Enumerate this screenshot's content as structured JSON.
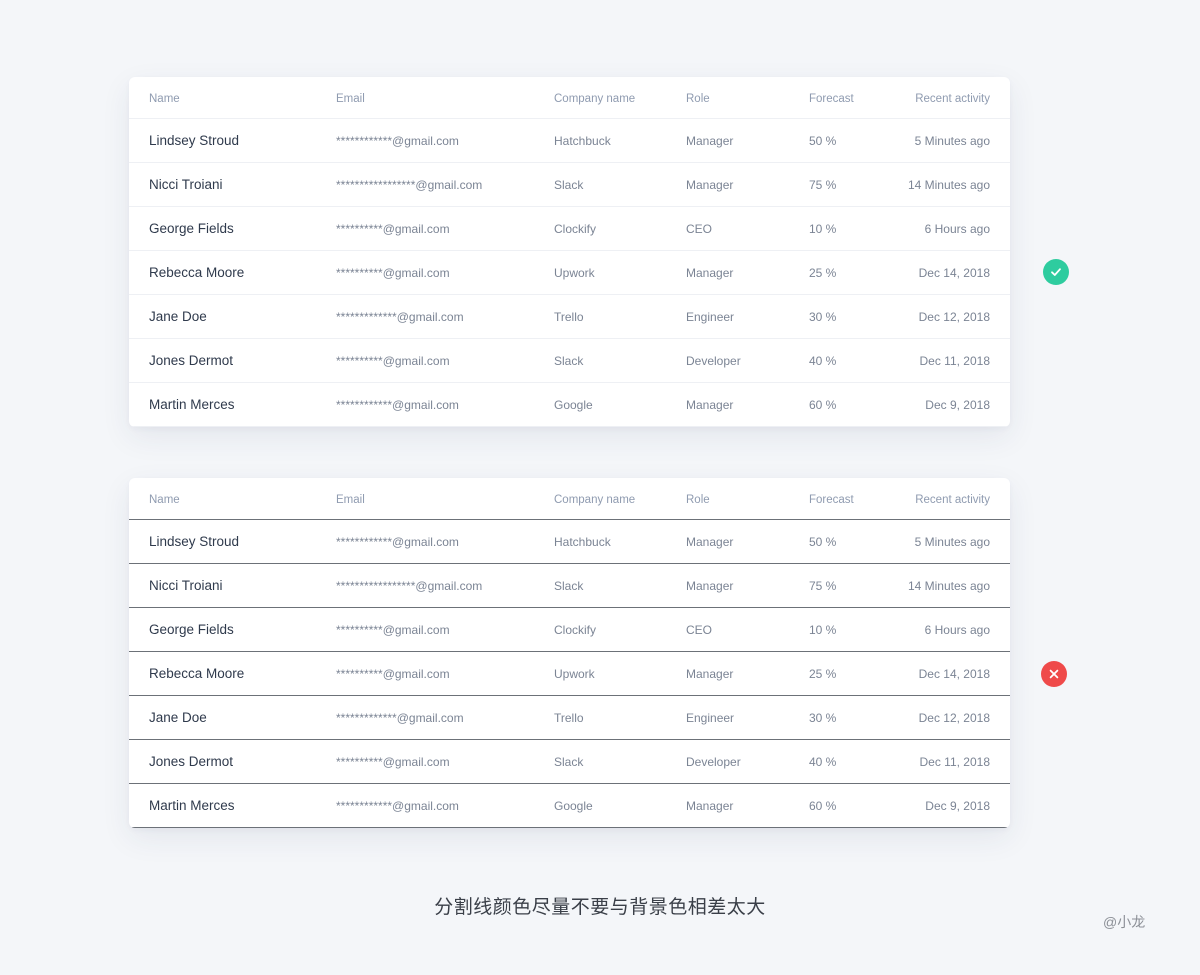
{
  "columns": [
    "Name",
    "Email",
    "Company name",
    "Role",
    "Forecast",
    "Recent activity"
  ],
  "rows": [
    {
      "name": "Lindsey Stroud",
      "email": "************@gmail.com",
      "company": "Hatchbuck",
      "role": "Manager",
      "forecast": "50 %",
      "recent": "5 Minutes ago"
    },
    {
      "name": "Nicci Troiani",
      "email": "*****************@gmail.com",
      "company": "Slack",
      "role": "Manager",
      "forecast": "75 %",
      "recent": "14 Minutes ago"
    },
    {
      "name": "George Fields",
      "email": "**********@gmail.com",
      "company": "Clockify",
      "role": "CEO",
      "forecast": "10 %",
      "recent": "6 Hours ago"
    },
    {
      "name": "Rebecca Moore",
      "email": "**********@gmail.com",
      "company": "Upwork",
      "role": "Manager",
      "forecast": "25 %",
      "recent": "Dec 14, 2018"
    },
    {
      "name": "Jane Doe",
      "email": "*************@gmail.com",
      "company": "Trello",
      "role": "Engineer",
      "forecast": "30 %",
      "recent": "Dec 12, 2018"
    },
    {
      "name": "Jones Dermot",
      "email": "**********@gmail.com",
      "company": "Slack",
      "role": "Developer",
      "forecast": "40 %",
      "recent": "Dec 11, 2018"
    },
    {
      "name": "Martin Merces",
      "email": "************@gmail.com",
      "company": "Google",
      "role": "Manager",
      "forecast": "60 %",
      "recent": "Dec 9, 2018"
    }
  ],
  "badges": {
    "good": {
      "icon": "check-icon",
      "color": "#2ecc9f"
    },
    "bad": {
      "icon": "close-icon",
      "color": "#ef4a4a"
    }
  },
  "caption": "分割线颜色尽量不要与背景色相差太大",
  "signature": "@小龙"
}
